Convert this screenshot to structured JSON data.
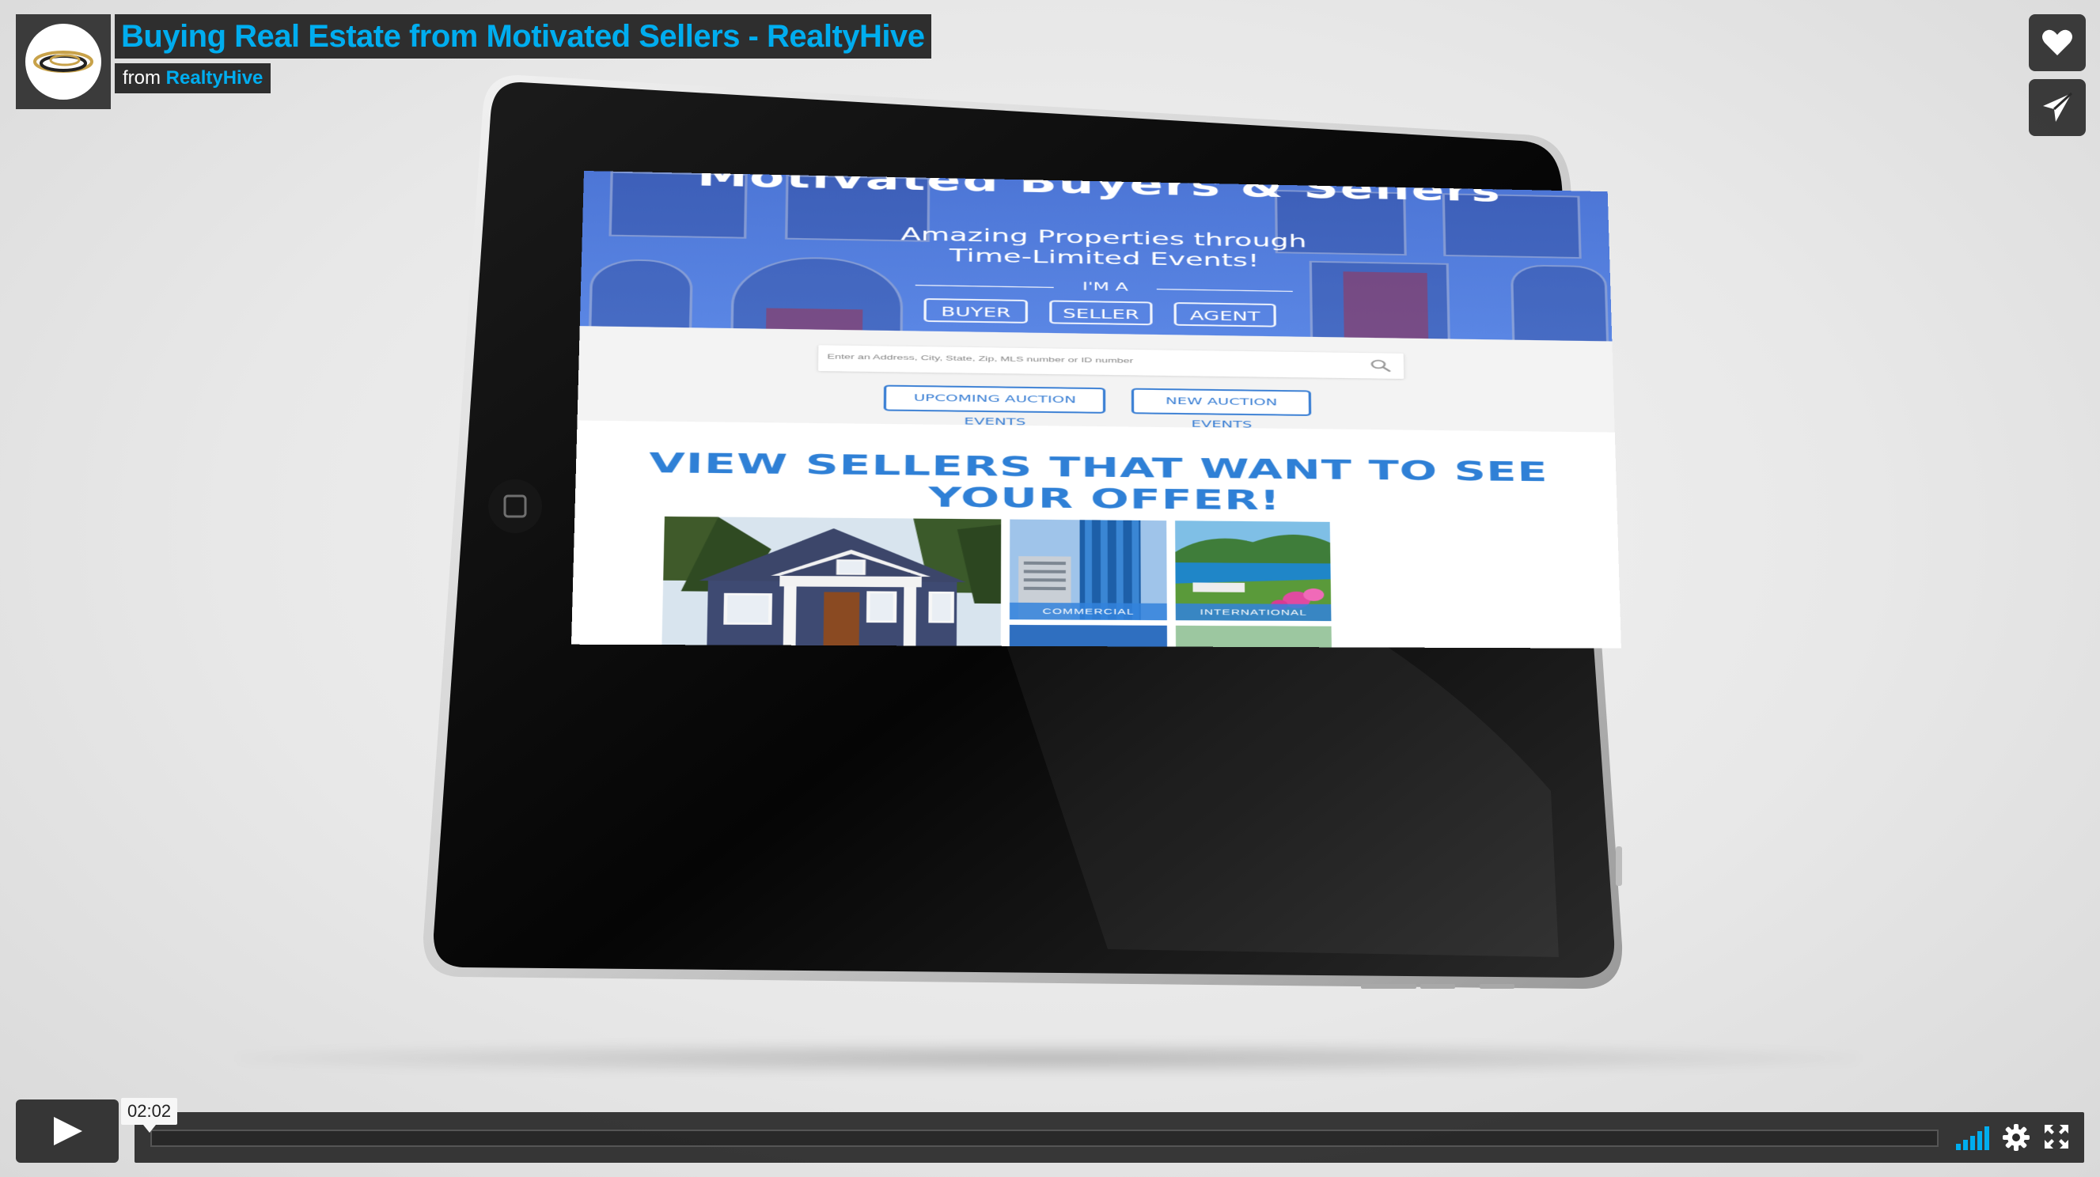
{
  "video": {
    "title": "Buying Real Estate from Motivated Sellers - RealtyHive",
    "byline_prefix": "from",
    "owner": "RealtyHive",
    "time": "02:02",
    "progress": 0.0,
    "accent_color": "#00adef"
  },
  "icons": {
    "like": "heart-icon",
    "share": "paper-plane-icon",
    "play": "play-icon",
    "volume": "volume-bars-icon",
    "settings": "gear-icon",
    "fullscreen": "fullscreen-icon"
  },
  "site": {
    "hero_title": "Motivated Buyers & Sellers",
    "hero_subtitle_line1": "Amazing Properties through",
    "hero_subtitle_line2": "Time-Limited Events!",
    "im_a": "I'M A",
    "roles": [
      "BUYER",
      "SELLER",
      "AGENT"
    ],
    "search_placeholder": "Enter an Address, City, State, Zip, MLS number or ID number",
    "event_buttons": [
      "UPCOMING AUCTION EVENTS",
      "NEW AUCTION EVENTS"
    ],
    "section_title": "VIEW SELLERS THAT WANT TO SEE YOUR OFFER!",
    "categories": [
      "COMMERCIAL",
      "INTERNATIONAL"
    ]
  }
}
